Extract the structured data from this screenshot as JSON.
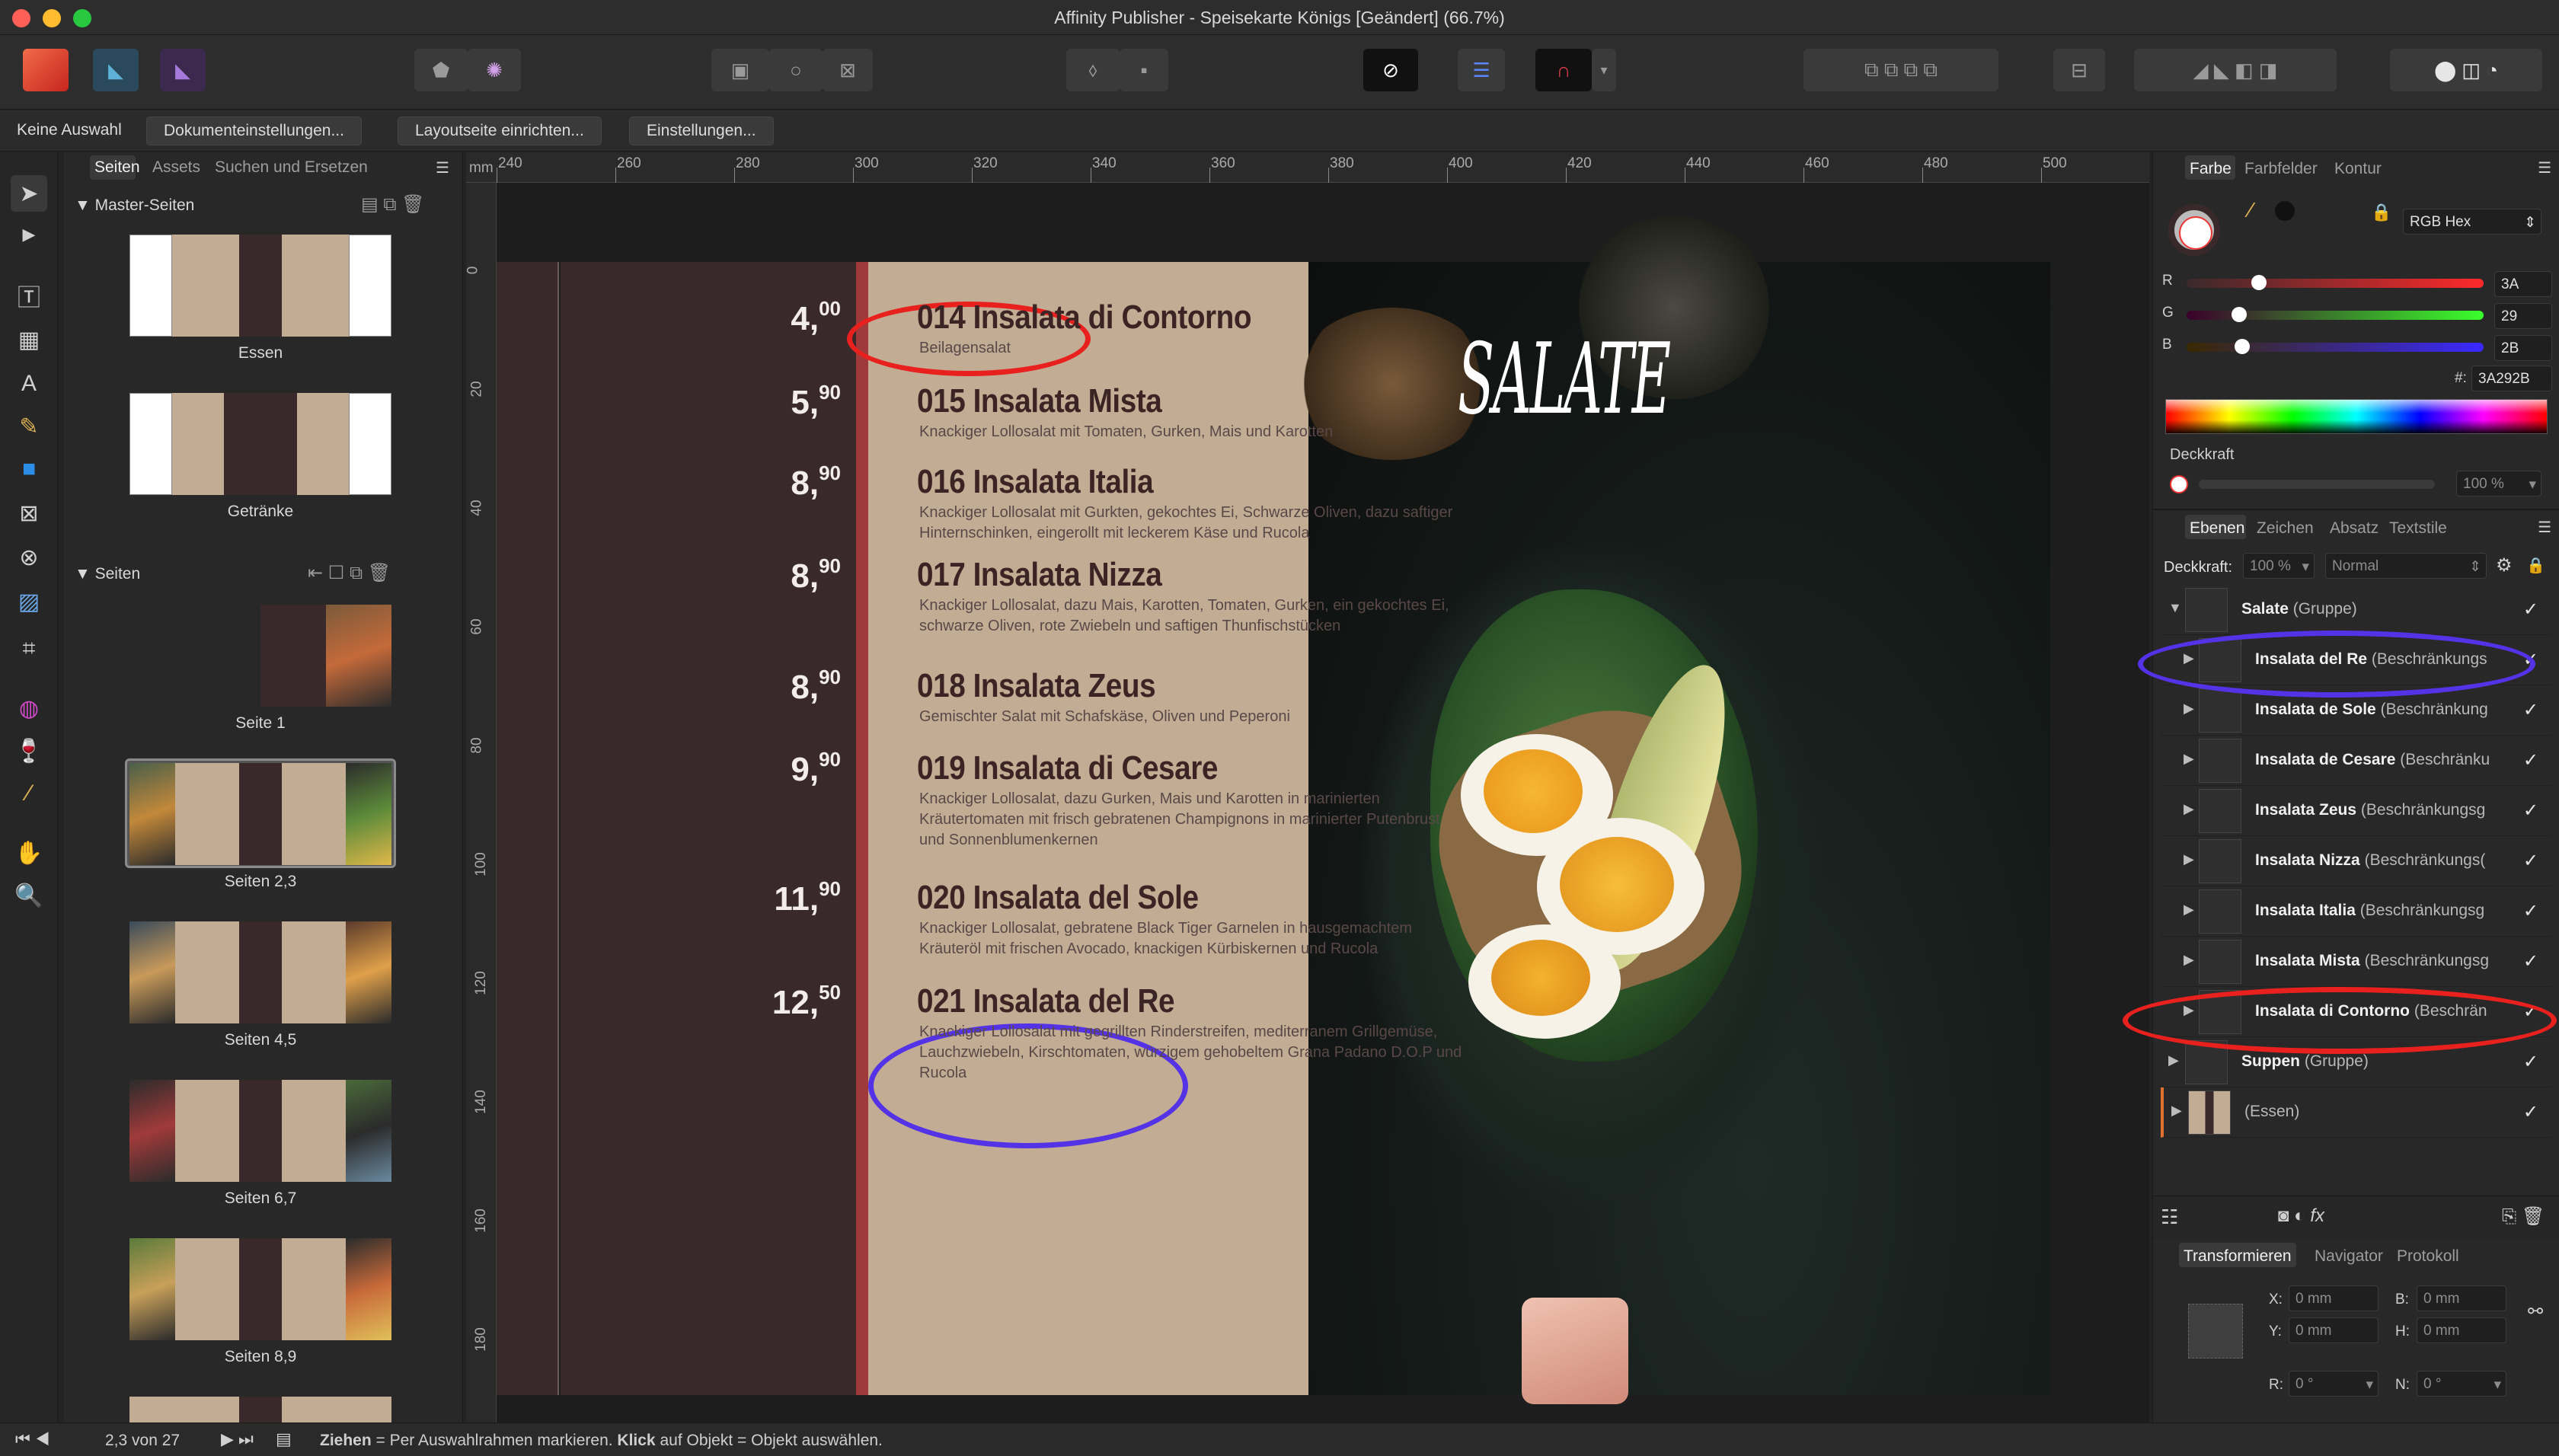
{
  "window": {
    "title": "Affinity Publisher - Speisekarte Königs [Geändert] (66.7%)"
  },
  "context_bar": {
    "selection": "Keine Auswahl",
    "buttons": [
      "Dokumenteinstellungen...",
      "Layoutseite einrichten...",
      "Einstellungen..."
    ]
  },
  "pages_panel": {
    "tabs": [
      "Seiten",
      "Assets",
      "Suchen und Ersetzen"
    ],
    "master_section": "Master-Seiten",
    "masters": [
      "Essen",
      "Getränke"
    ],
    "pages_section": "Seiten",
    "pages": [
      "Seite 1",
      "Seiten 2,3",
      "Seiten 4,5",
      "Seiten 6,7",
      "Seiten 8,9"
    ]
  },
  "ruler": {
    "unit": "mm",
    "h_ticks": [
      "240",
      "260",
      "280",
      "300",
      "320",
      "340",
      "360",
      "380",
      "400",
      "420",
      "440",
      "460",
      "480",
      "500"
    ],
    "v_ticks": [
      "0",
      "20",
      "40",
      "60",
      "80",
      "100",
      "120",
      "140",
      "160",
      "180"
    ]
  },
  "menu": {
    "section_title": "SALATE",
    "items": [
      {
        "code": "014 Insalata di Contorno",
        "desc": "Beilagensalat",
        "price": "4,",
        "cents": "00"
      },
      {
        "code": "015 Insalata Mista",
        "desc": "Knackiger Lollosalat mit Tomaten, Gurken, Mais und Karotten",
        "price": "5,",
        "cents": "90"
      },
      {
        "code": "016 Insalata Italia",
        "desc": "Knackiger Lollosalat mit Gurkten, gekochtes Ei, Schwarze Oliven, dazu saftiger Hinternschinken, eingerollt mit leckerem Käse und Rucola",
        "price": "8,",
        "cents": "90"
      },
      {
        "code": "017 Insalata Nizza",
        "desc": "Knackiger Lollosalat, dazu Mais, Karotten, Tomaten, Gurken, ein gekochtes Ei, schwarze Oliven, rote Zwiebeln und saftigen Thunfischstücken",
        "price": "8,",
        "cents": "90"
      },
      {
        "code": "018 Insalata Zeus",
        "desc": "Gemischter Salat mit Schafskäse, Oliven und Peperoni",
        "price": "8,",
        "cents": "90"
      },
      {
        "code": "019 Insalata di Cesare",
        "desc": "Knackiger Lollosalat, dazu Gurken, Mais und Karotten in marinierten Kräutertomaten mit frisch gebratenen Champignons in marinierter Putenbrust und Sonnenblumenkernen",
        "price": "9,",
        "cents": "90"
      },
      {
        "code": "020 Insalata del Sole",
        "desc": "Knackiger Lollosalat, gebratene Black Tiger Garnelen in hausgemachtem Kräuteröl mit frischen Avocado, knackigen Kürbiskernen und Rucola",
        "price": "11,",
        "cents": "90"
      },
      {
        "code": "021 Insalata del Re",
        "desc": "Knackiger Lollosalat mit gegrillten Rinderstreifen, mediterranem Grillgemüse, Lauchzwiebeln, Kirschtomaten, würzigem gehobeltem Grana Padano D.O.P und Rucola",
        "price": "12,",
        "cents": "50"
      }
    ]
  },
  "color_panel": {
    "tabs": [
      "Farbe",
      "Farbfelder",
      "Kontur"
    ],
    "model": "RGB Hex",
    "r": "3A",
    "g": "29",
    "b": "2B",
    "hex_label": "#:",
    "hex": "3A292B",
    "opacity_label": "Deckkraft",
    "opacity": "100 %",
    "channel_r": "R",
    "channel_g": "G",
    "channel_b": "B",
    "r_level": 0.23,
    "g_level": 0.16,
    "b_level": 0.17
  },
  "layers_panel": {
    "tabs": [
      "Ebenen",
      "Zeichen",
      "Absatz",
      "Textstile"
    ],
    "opacity_label": "Deckkraft:",
    "opacity": "100 %",
    "blend": "Normal",
    "layers": [
      {
        "name": "Salate",
        "type": "(Gruppe)",
        "check": "✓"
      },
      {
        "name": "Insalata del Re",
        "type": "(Beschränkungs",
        "check": "✓"
      },
      {
        "name": "Insalata de Sole",
        "type": "(Beschränkung",
        "check": "✓"
      },
      {
        "name": "Insalata de Cesare",
        "type": "(Beschränku",
        "check": "✓"
      },
      {
        "name": "Insalata Zeus",
        "type": "(Beschränkungsg",
        "check": "✓"
      },
      {
        "name": "Insalata Nizza",
        "type": "(Beschränkungs(",
        "check": "✓"
      },
      {
        "name": "Insalata Italia",
        "type": "(Beschränkungsg",
        "check": "✓"
      },
      {
        "name": "Insalata Mista",
        "type": "(Beschränkungsg",
        "check": "✓"
      },
      {
        "name": "Insalata di Contorno",
        "type": "(Beschrän",
        "check": "✓"
      },
      {
        "name": "Suppen",
        "type": "(Gruppe)",
        "check": "✓"
      },
      {
        "name": "",
        "type": "(Essen)",
        "check": "✓"
      }
    ]
  },
  "transform_panel": {
    "tabs": [
      "Transformieren",
      "Navigator",
      "Protokoll"
    ],
    "x_label": "X:",
    "x": "0 mm",
    "y_label": "Y:",
    "y": "0 mm",
    "b_label": "B:",
    "b": "0 mm",
    "h_label": "H:",
    "h": "0 mm",
    "r_label": "R:",
    "r": "0 °",
    "n_label": "N:",
    "n": "0 °"
  },
  "status_bar": {
    "page": "2,3 von 27",
    "hint_bold1": "Ziehen",
    "hint1": " = Per Auswahlrahmen markieren. ",
    "hint_bold2": "Klick",
    "hint2": " auf Objekt = Objekt auswählen."
  },
  "colors": {
    "accent": "#4f86f7",
    "menu_bg": "#c2ad94",
    "menu_dark": "#3a292b",
    "annot_red": "#e8201e",
    "annot_blue": "#5433e6"
  }
}
